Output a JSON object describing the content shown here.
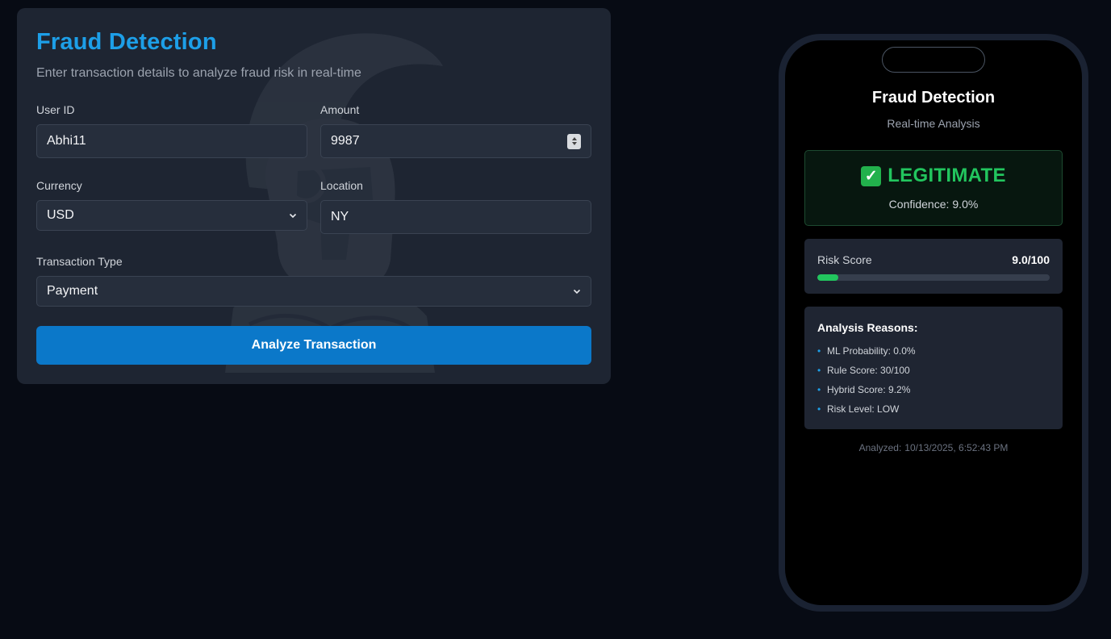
{
  "form": {
    "title": "Fraud Detection",
    "subtitle": "Enter transaction details to analyze fraud risk in real-time",
    "user_id": {
      "label": "User ID",
      "value": "Abhi11"
    },
    "amount": {
      "label": "Amount",
      "value": "9987"
    },
    "currency": {
      "label": "Currency",
      "value": "USD"
    },
    "location": {
      "label": "Location",
      "value": "NY"
    },
    "transaction_type": {
      "label": "Transaction Type",
      "value": "Payment"
    },
    "submit_label": "Analyze Transaction",
    "watermark_icon": "spartan-helmet-icon"
  },
  "phone": {
    "title": "Fraud Detection",
    "subtitle": "Real-time Analysis",
    "verdict": {
      "icon": "check-mark-icon",
      "text": "LEGITIMATE",
      "color": "#22c55e",
      "confidence_label": "Confidence:",
      "confidence_value": "9.0%"
    },
    "risk": {
      "label": "Risk Score",
      "value": "9.0/100",
      "fraction": 0.09,
      "color": "#22c55e"
    },
    "reasons": {
      "title": "Analysis Reasons:",
      "items": [
        "ML Probability: 0.0%",
        "Rule Score: 30/100",
        "Hybrid Score: 9.2%",
        "Risk Level: LOW"
      ]
    },
    "analyzed_label": "Analyzed:",
    "analyzed_value": "10/13/2025, 6:52:43 PM"
  },
  "colors": {
    "accent": "#1d9fe8",
    "button": "#0b78c9",
    "background": "#070b14"
  }
}
